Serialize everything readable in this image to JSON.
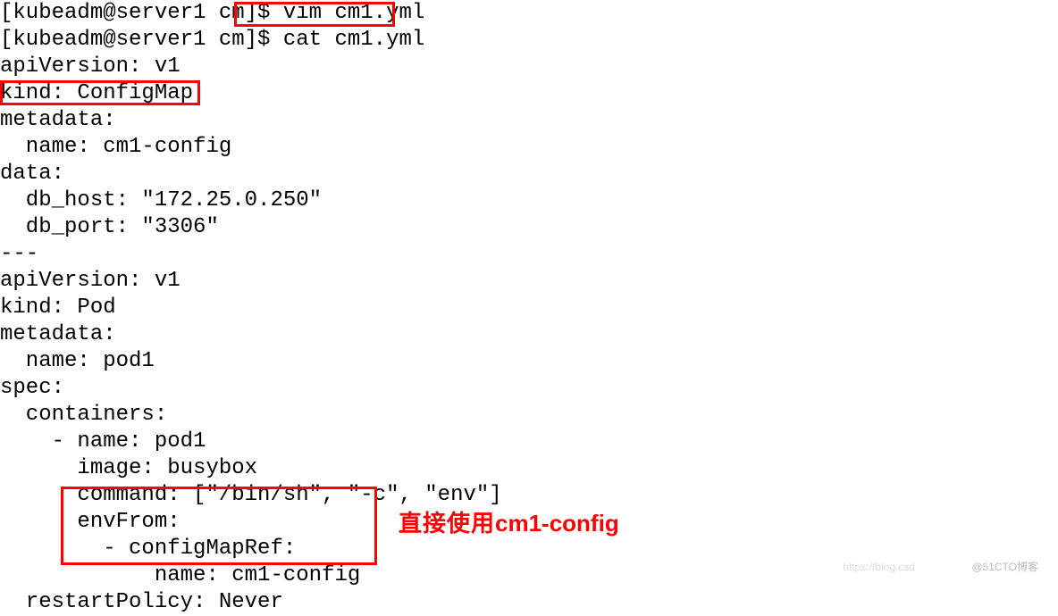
{
  "terminal": {
    "lines": [
      "[kubeadm@server1 cm]$ vim cm1.yml",
      "[kubeadm@server1 cm]$ cat cm1.yml",
      "apiVersion: v1",
      "kind: ConfigMap",
      "metadata:",
      "  name: cm1-config",
      "data:",
      "  db_host: \"172.25.0.250\"",
      "  db_port: \"3306\"",
      "---",
      "apiVersion: v1",
      "kind: Pod",
      "metadata:",
      "  name: pod1",
      "spec:",
      "  containers:",
      "    - name: pod1",
      "      image: busybox",
      "      command: [\"/bin/sh\", \"-c\", \"env\"]",
      "      envFrom:",
      "        - configMapRef:",
      "            name: cm1-config",
      "  restartPolicy: Never"
    ]
  },
  "annotation": {
    "text_cn": "直接使用",
    "text_en": "cm1-config"
  },
  "watermarks": {
    "left": "https://blog.csd",
    "right": "@51CTO博客"
  }
}
